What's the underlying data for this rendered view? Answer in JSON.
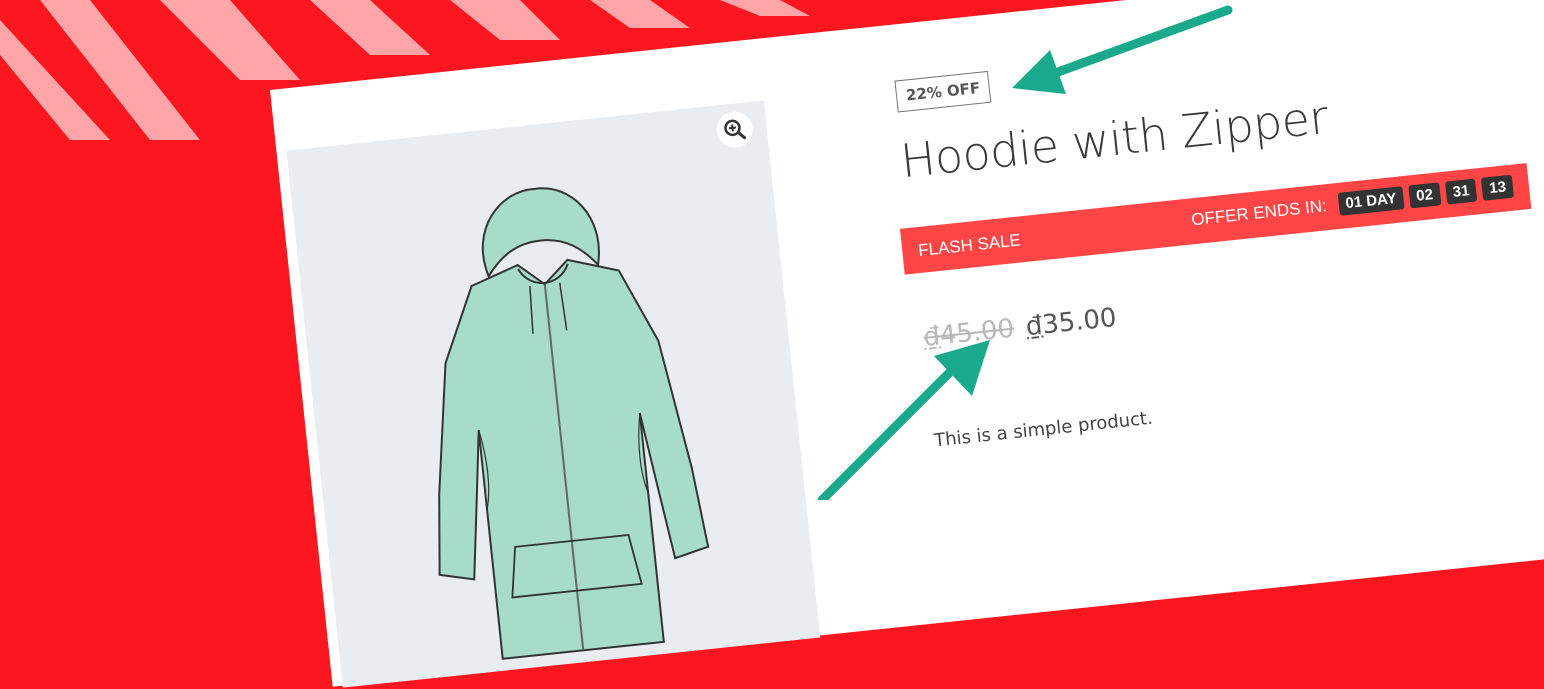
{
  "product": {
    "badge": "22% OFF",
    "title": "Hoodie with Zipper",
    "image_icon": "hoodie-image",
    "zoom_icon": "magnify-plus-icon",
    "price_old": "45.00",
    "price_new": "35.00",
    "currency": "₫",
    "description": "This is a simple product."
  },
  "flash_sale": {
    "label": "FLASH SALE",
    "offer_label": "OFFER ENDS IN:",
    "countdown": {
      "days": "01 DAY",
      "hours": "02",
      "minutes": "31",
      "seconds": "13"
    }
  },
  "colors": {
    "background": "#fb1620",
    "stripe": "#ffa5a8",
    "flash_bar": "#ff4545",
    "countdown_box": "#333333",
    "arrow": "#1aa98a",
    "hoodie": "#a6dcc9"
  }
}
